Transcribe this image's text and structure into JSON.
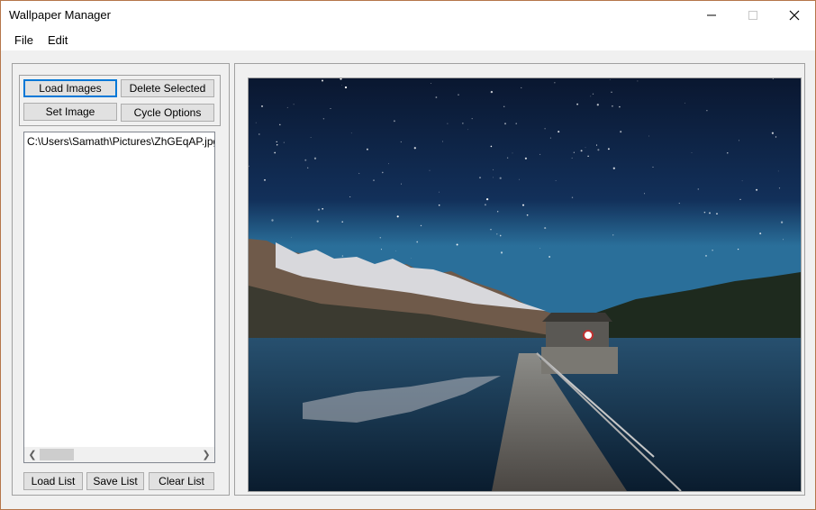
{
  "window": {
    "title": "Wallpaper Manager"
  },
  "menu": {
    "file": "File",
    "edit": "Edit"
  },
  "buttons": {
    "load_images": "Load Images",
    "delete_selected": "Delete Selected",
    "set_image": "Set Image",
    "cycle_options": "Cycle Options",
    "load_list": "Load List",
    "save_list": "Save List",
    "clear_list": "Clear List"
  },
  "image_list": {
    "items": [
      "C:\\Users\\Samath\\Pictures\\ZhGEqAP.jpg"
    ]
  },
  "preview": {
    "scene": "starry-night-lake-pier"
  },
  "colors": {
    "focus_border": "#0078d7",
    "window_border": "#b5764a"
  }
}
